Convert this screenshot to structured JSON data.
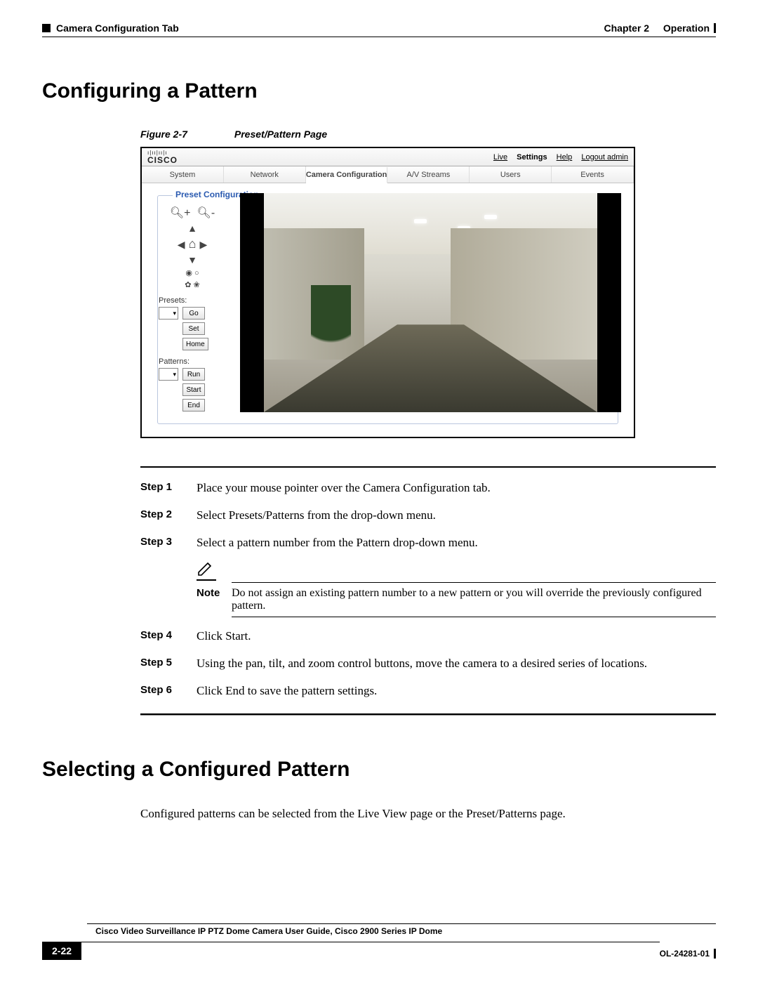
{
  "header": {
    "left": "Camera Configuration Tab",
    "chapter": "Chapter 2",
    "chapter_title": "Operation"
  },
  "section1_title": "Configuring a Pattern",
  "figure": {
    "label": "Figure 2-7",
    "title": "Preset/Pattern Page",
    "brand": "CISCO",
    "nav": {
      "live": "Live",
      "settings": "Settings",
      "help": "Help",
      "logout": "Logout admin"
    },
    "tabs": [
      "System",
      "Network",
      "Camera Configuration",
      "A/V Streams",
      "Users",
      "Events"
    ],
    "fieldset": "Preset Configuration",
    "presets_label": "Presets:",
    "patterns_label": "Patterns:",
    "buttons": {
      "go": "Go",
      "set": "Set",
      "home": "Home",
      "run": "Run",
      "start": "Start",
      "end": "End"
    }
  },
  "steps": {
    "s1_label": "Step 1",
    "s1_text": "Place your mouse pointer over the Camera Configuration tab.",
    "s2_label": "Step 2",
    "s2_text": "Select Presets/Patterns from the drop-down menu.",
    "s3_label": "Step 3",
    "s3_text": "Select a pattern number from the Pattern drop-down menu.",
    "note_label": "Note",
    "note_text": "Do not assign an existing pattern number to a new pattern or you will override the previously configured pattern.",
    "s4_label": "Step 4",
    "s4_text": "Click Start.",
    "s5_label": "Step 5",
    "s5_text": "Using the pan, tilt, and zoom control buttons, move the camera to a desired series of locations.",
    "s6_label": "Step 6",
    "s6_text": "Click End to save the pattern settings."
  },
  "section2_title": "Selecting a Configured Pattern",
  "section2_para": "Configured patterns can be selected from the Live View page or the Preset/Patterns page.",
  "footer": {
    "title": "Cisco Video Surveillance IP PTZ Dome Camera User Guide, Cisco 2900 Series IP Dome",
    "page": "2-22",
    "docid": "OL-24281-01"
  }
}
